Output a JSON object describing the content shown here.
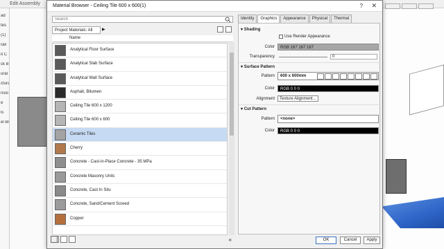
{
  "background": {
    "title": "Edit Assembly",
    "left_strip_labels": [
      "ad",
      "tes",
      "(1)",
      "rail",
      "it C",
      "ck B",
      "ural",
      "ctura",
      "nsio",
      "e",
      "ls",
      "el Br"
    ],
    "accent_floor_color": "#2f66c8"
  },
  "dialog": {
    "title": "Material Browser - Ceiling Tile 600 x 600(1)",
    "help_label": "?",
    "close_label": "✕"
  },
  "left_pane": {
    "search_placeholder": "Search",
    "project_filter_label": "Project Materials: All",
    "column_header": "Name",
    "materials": [
      {
        "label": "Analytical Floor Surface",
        "thumb_color": "#5a5a5a",
        "selected": false
      },
      {
        "label": "Analytical Slab Surface",
        "thumb_color": "#5a5a5a",
        "selected": false
      },
      {
        "label": "Analytical Wall Surface",
        "thumb_color": "#5a5a5a",
        "selected": false
      },
      {
        "label": "Asphalt, Bitumen",
        "thumb_color": "#2a2a2a",
        "selected": false
      },
      {
        "label": "Ceiling Tile 600 x 1200",
        "thumb_color": "#b5b5b5",
        "selected": false
      },
      {
        "label": "Ceiling Tile 600 x 600",
        "thumb_color": "#b5b5b5",
        "selected": false
      },
      {
        "label": "Ceramic Tiles",
        "thumb_color": "#a3a3a3",
        "selected": true
      },
      {
        "label": "Cherry",
        "thumb_color": "#b07a4d",
        "selected": false
      },
      {
        "label": "Concrete - Cast-in-Place Concrete - 35 MPa",
        "thumb_color": "#8e8e8e",
        "selected": false
      },
      {
        "label": "Concrete Masonry Units",
        "thumb_color": "#9a9a9a",
        "selected": false
      },
      {
        "label": "Concrete, Cast In Situ",
        "thumb_color": "#8a8a8a",
        "selected": false
      },
      {
        "label": "Concrete, Sand/Cement Screed",
        "thumb_color": "#9b9b9b",
        "selected": false
      },
      {
        "label": "Copper",
        "thumb_color": "#b3703e",
        "selected": false
      }
    ]
  },
  "right_pane": {
    "tabs": [
      {
        "label": "Identity",
        "active": false
      },
      {
        "label": "Graphics",
        "active": true
      },
      {
        "label": "Appearance",
        "active": false
      },
      {
        "label": "Physical",
        "active": false
      },
      {
        "label": "Thermal",
        "active": false
      }
    ],
    "shading": {
      "header": "Shading",
      "use_render_label": "Use Render Appearance",
      "use_render_checked": false,
      "color_label": "Color",
      "color_value": "RGB 167 167 167",
      "color_hex": "#a7a7a7",
      "transparency_label": "Transparency",
      "transparency_value": "0"
    },
    "surface_pattern": {
      "header": "Surface Pattern",
      "pattern_label": "Pattern",
      "pattern_value": "600 x 600mm",
      "color_label": "Color",
      "color_value": "RGB 0 0 0",
      "color_hex": "#000000",
      "alignment_label": "Alignment",
      "alignment_button": "Texture Alignment..."
    },
    "cut_pattern": {
      "header": "Cut Pattern",
      "pattern_label": "Pattern",
      "pattern_value": "<none>",
      "color_label": "Color",
      "color_value": "RGB 0 0 0",
      "color_hex": "#000000"
    }
  },
  "footer": {
    "ok_label": "OK",
    "cancel_label": "Cancel",
    "apply_label": "Apply"
  }
}
